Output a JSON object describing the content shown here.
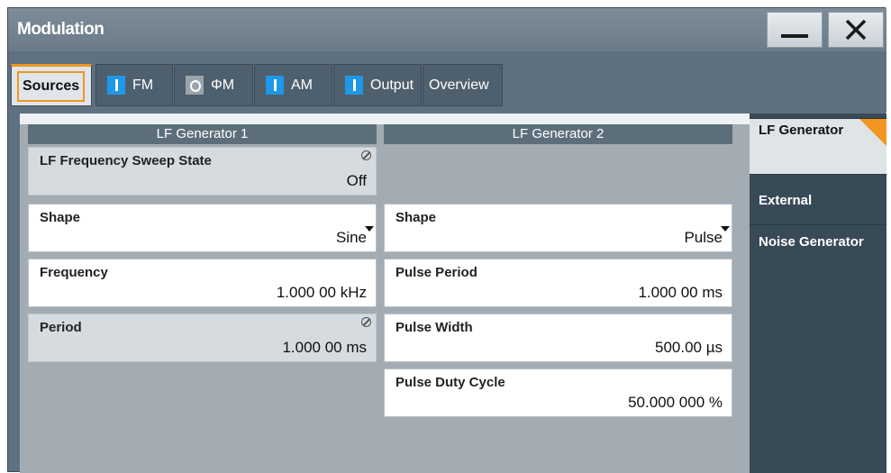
{
  "window": {
    "title": "Modulation"
  },
  "tabs": [
    {
      "label": "Sources",
      "indicator": "none"
    },
    {
      "label": "FM",
      "indicator": "blue"
    },
    {
      "label": "ΦM",
      "indicator": "grey"
    },
    {
      "label": "AM",
      "indicator": "blue"
    },
    {
      "label": "Output",
      "indicator": "blue"
    },
    {
      "label": "Overview",
      "indicator": "none"
    }
  ],
  "lf1": {
    "header": "LF Generator 1",
    "sweep_label": "LF Frequency Sweep State",
    "sweep_value": "Off",
    "shape_label": "Shape",
    "shape_value": "Sine",
    "freq_label": "Frequency",
    "freq_value": "1.000 00 kHz",
    "period_label": "Period",
    "period_value": "1.000 00 ms"
  },
  "lf2": {
    "header": "LF Generator 2",
    "shape_label": "Shape",
    "shape_value": "Pulse",
    "pperiod_label": "Pulse Period",
    "pperiod_value": "1.000 00 ms",
    "pwidth_label": "Pulse Width",
    "pwidth_value": "500.00 µs",
    "pduty_label": "Pulse Duty Cycle",
    "pduty_value": "50.000 000 %"
  },
  "sidebar": {
    "items": [
      {
        "label": "LF Generator"
      },
      {
        "label": "External"
      },
      {
        "label": "Noise Generator"
      }
    ]
  },
  "colors": {
    "accent": "#f0961e",
    "indicator_on": "#1e98e8",
    "indicator_off": "#9aa4ab"
  }
}
